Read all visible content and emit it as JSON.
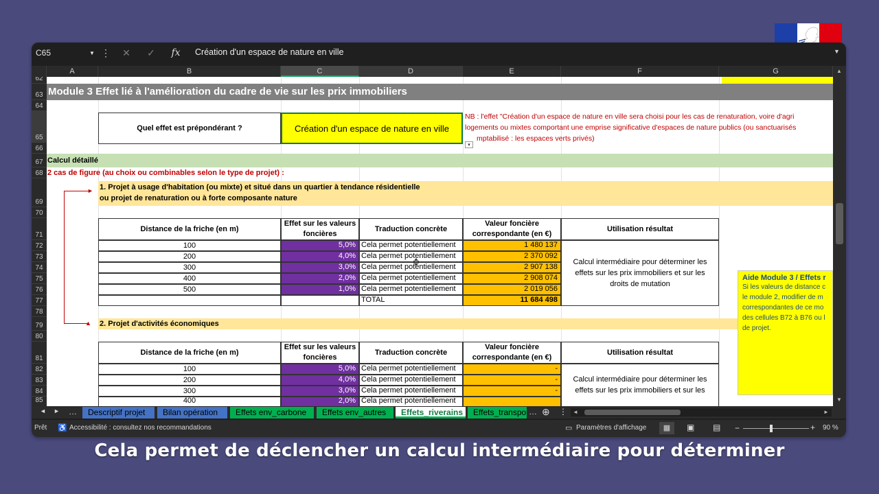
{
  "caption": "Cela permet de déclencher un calcul intermédiaire pour déterminer",
  "formula_bar": {
    "name_box": "C65",
    "formula": "Création d'un espace de nature en ville"
  },
  "columns": [
    "A",
    "B",
    "C",
    "D",
    "E",
    "F",
    "G"
  ],
  "rows": {
    "r62": "62",
    "r63": "63",
    "r64": "64",
    "r65": "65",
    "r66": "66",
    "r67": "67",
    "r68": "68",
    "r69": "69",
    "r70": "70",
    "r71": "71",
    "r72": "72",
    "r73": "73",
    "r74": "74",
    "r75": "75",
    "r76": "76",
    "r77": "77",
    "r78": "78",
    "r79": "79",
    "r80": "80",
    "r81": "81",
    "r82": "82",
    "r83": "83",
    "r84": "84",
    "r85": "85"
  },
  "sheet": {
    "module_title": "Module 3 Effet lié à l'amélioration du cadre de vie sur les prix immobiliers",
    "question_label": "Quel effet est prépondérant ?",
    "question_value": "Création d'un espace de nature en ville",
    "nb_line1": "NB : l'effet \"Création d'un espace de nature en ville sera choisi pour les cas de renaturation, voire d'agri",
    "nb_line2": "logements ou mixtes comportant une emprise significative d'espaces de nature publics (ou sanctuarisés",
    "nb_line3": "mptabilisé : les espaces verts privés)",
    "calc_detail": "Calcul détaillé",
    "cases": "2 cas de figure (au choix ou combinables selon le type de projet) :",
    "case1_line1": "1. Projet à usage d'habitation (ou mixte) et situé dans un quartier à tendance résidentielle",
    "case1_line2": "ou projet de renaturation ou à forte composante nature",
    "case2": "2. Projet d'activités économiques",
    "headers": {
      "distance": "Distance de la friche (en m)",
      "effet": "Effet sur les valeurs foncières",
      "traduction": "Traduction concrète",
      "valeur": "Valeur foncière correspondante (en €)",
      "utilisation": "Utilisation résultat"
    },
    "table1": [
      {
        "distance": "100",
        "effet": "5,0%",
        "traduction": "Cela permet potentiellement",
        "valeur": "1 480 137"
      },
      {
        "distance": "200",
        "effet": "4,0%",
        "traduction": "Cela permet potentiellement",
        "valeur": "2 370 092"
      },
      {
        "distance": "300",
        "effet": "3,0%",
        "traduction": "Cela permet potentiellement",
        "valeur": "2 907 138"
      },
      {
        "distance": "400",
        "effet": "2,0%",
        "traduction": "Cela permet potentiellement",
        "valeur": "2 908 074"
      },
      {
        "distance": "500",
        "effet": "1,0%",
        "traduction": "Cela permet potentiellement",
        "valeur": "2 019 056"
      }
    ],
    "total_label": "TOTAL",
    "total_value": "11 684 498",
    "utilisation_text": "Calcul intermédiaire pour déterminer les effets sur les prix immobiliers et sur les droits de mutation",
    "utilisation_text2": "Calcul intermédiaire pour déterminer les effets sur les prix immobiliers et sur les",
    "table2": [
      {
        "distance": "100",
        "effet": "5,0%",
        "traduction": "Cela permet potentiellement",
        "valeur": "-"
      },
      {
        "distance": "200",
        "effet": "4,0%",
        "traduction": "Cela permet potentiellement",
        "valeur": "-"
      },
      {
        "distance": "300",
        "effet": "3,0%",
        "traduction": "Cela permet potentiellement",
        "valeur": "-"
      },
      {
        "distance": "400",
        "effet": "2,0%",
        "traduction": "Cela permet potentiellement",
        "valeur": ""
      }
    ],
    "aide_title": "Aide Module 3 / Effets r",
    "aide_lines": [
      "Si les valeurs de distance c",
      "le module 2, modifier de m",
      "correspondantes de ce mo",
      "des cellules B72 à B76 ou l",
      "de projet."
    ]
  },
  "tabs": [
    {
      "label": "Descriptif projet",
      "color": "#4472c4"
    },
    {
      "label": "Bilan opération",
      "color": "#4472c4"
    },
    {
      "label": "Effets env_carbone",
      "color": "#00b050"
    },
    {
      "label": "Effets env_autres",
      "color": "#00b050"
    },
    {
      "label": "Effets_riverains",
      "color": "#00b050"
    },
    {
      "label": "Effets_transpo",
      "color": "#00b050"
    }
  ],
  "status": {
    "ready": "Prêt",
    "accessibility": "Accessibilité : consultez nos recommandations",
    "display_settings": "Paramètres d'affichage",
    "zoom": "90 %"
  },
  "colors": {
    "purple": "#7030a0",
    "orange": "#ffc000",
    "banner": "#ffe699",
    "green_band": "#c6e0b4",
    "title_gray": "#808080",
    "yellow": "#ffff00"
  }
}
